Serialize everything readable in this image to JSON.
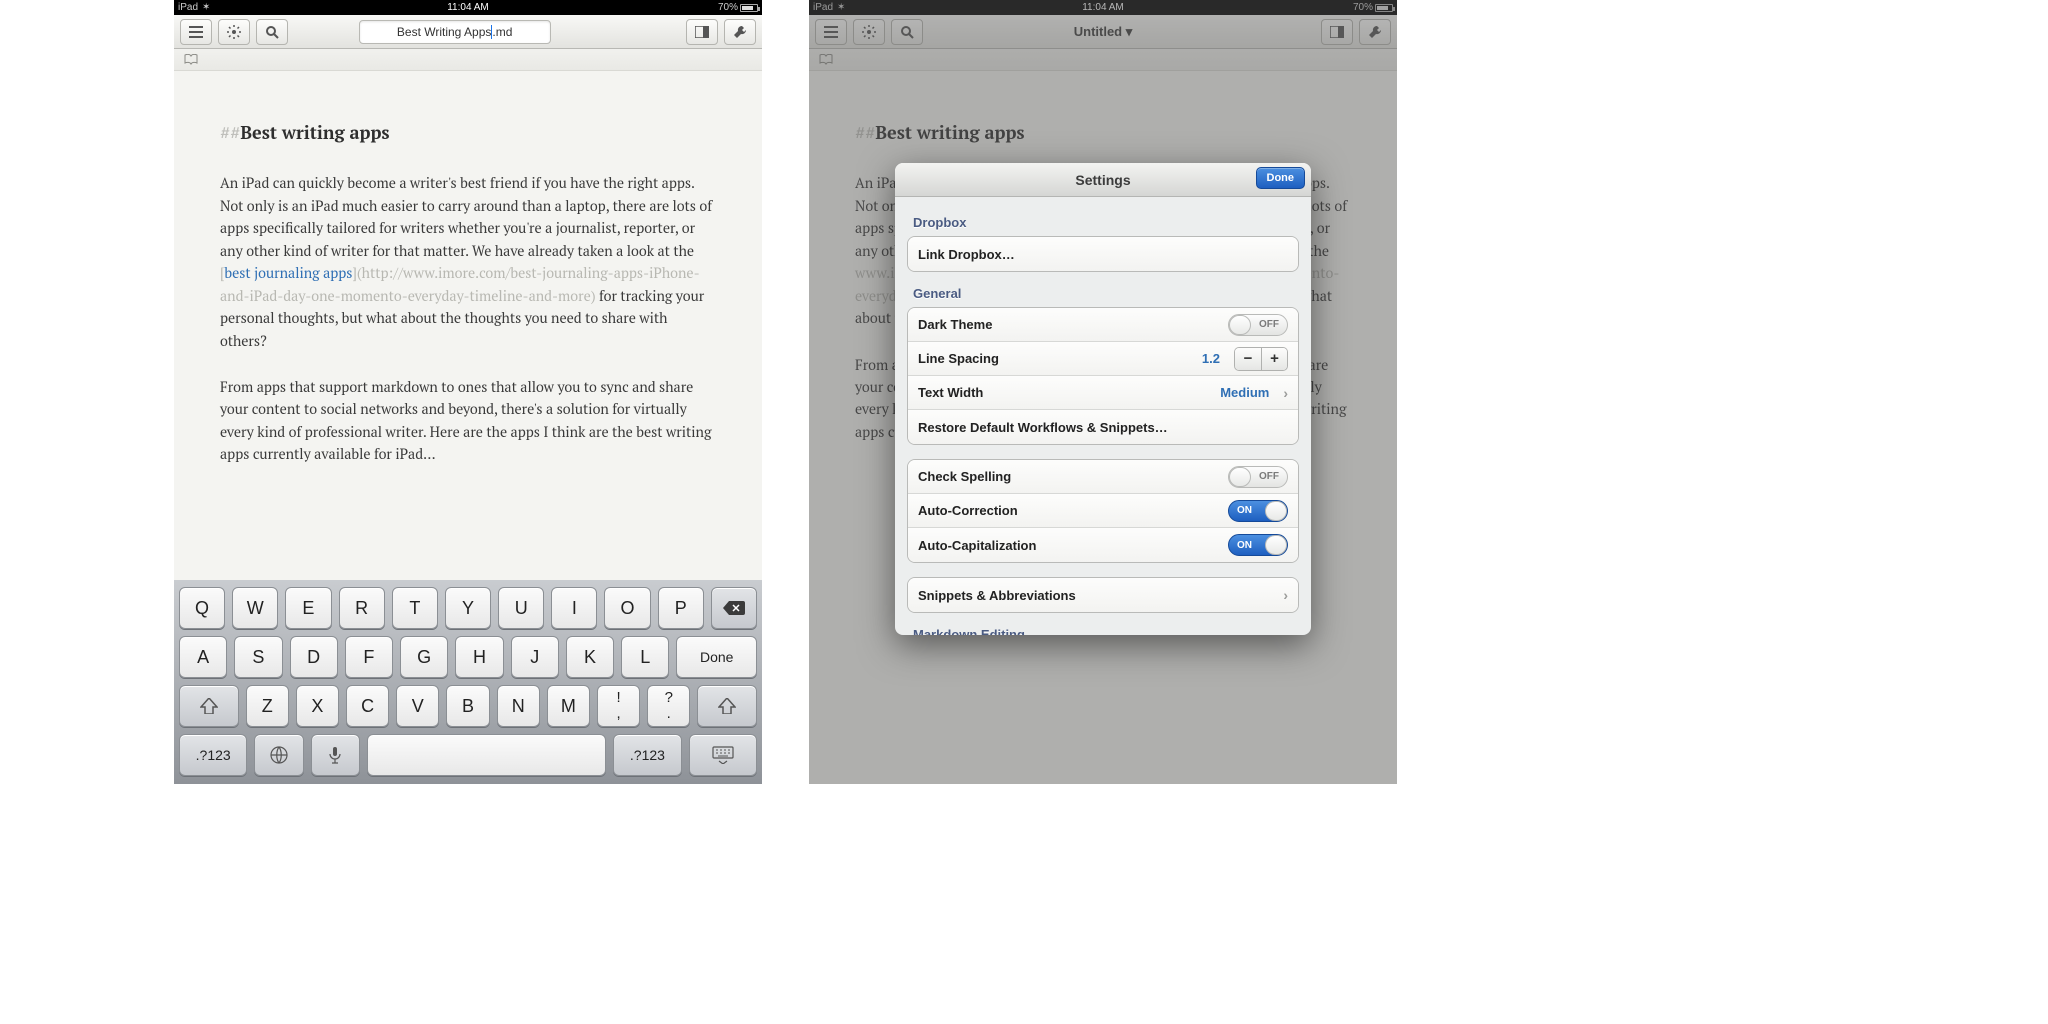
{
  "left": {
    "status": {
      "device": "iPad",
      "time": "11:04 AM",
      "battery": "70%"
    },
    "toolbar": {
      "title_before": "Best Writing Apps",
      "title_after": ".md"
    },
    "editor": {
      "heading_marker": "##",
      "heading": "Best writing apps",
      "p1_a": "An iPad can quickly become a writer's best friend if you have the right apps. Not only is an iPad much easier to  carry around than a laptop, there are lots of apps specifically tailored for writers whether you're a journalist, reporter, or any other kind of writer for that matter. We have already taken a look at the ",
      "link_open": "[",
      "link_text": "best journaling apps",
      "link_close": "]",
      "url": "(http://www.imore.com/best-journaling-apps-iPhone-and-iPad-day-one-momento-everyday-timeline-and-more)",
      "p1_b": " for tracking your personal thoughts, but what about the thoughts you need to share with others?",
      "p2": "From apps that support markdown to ones that allow you to sync and share your content to social networks and beyond, there's a solution for virtually every kind of professional writer. Here are the apps I think are the best writing apps currently available for iPad..."
    },
    "keyboard": {
      "row1": [
        "Q",
        "W",
        "E",
        "R",
        "T",
        "Y",
        "U",
        "I",
        "O",
        "P"
      ],
      "row2": [
        "A",
        "S",
        "D",
        "F",
        "G",
        "H",
        "J",
        "K",
        "L"
      ],
      "done": "Done",
      "row3": [
        "Z",
        "X",
        "C",
        "V",
        "B",
        "N",
        "M"
      ],
      "punct1_top": "!",
      "punct1_bot": ",",
      "punct2_top": "?",
      "punct2_bot": ".",
      "numkey": ".?123"
    }
  },
  "right": {
    "status": {
      "device": "iPad",
      "time": "11:04 AM",
      "battery": "70%"
    },
    "toolbar": {
      "title": "Untitled ▾"
    },
    "editor": {
      "heading_marker": "##",
      "heading": "Best writing apps",
      "p1_a": "An iPad can quickly become a writer's best friend if you have the right apps. Not only is an iPad much easier to  carry around than a laptop, there are lots of apps specifically tailored for writers whether you're a journalist, reporter, or any other kind of writer for that matter. We have already taken a look at the ",
      "url": "www.imore.com/best-journaling-apps-iPhone-and-iPad-day-one-momento-everyday-timeline-and-more)",
      "p1_b": " for tracking your personal thoughts, but what about the thoughts you need to share with others?",
      "p2": "From apps that support markdown to ones that allow you to sync and share your content to social networks and beyond, there's a solution for virtually every kind of professional writer. Here are the apps I think are the best writing apps currently available for iPad..."
    },
    "settings": {
      "title": "Settings",
      "done": "Done",
      "sec_dropbox": "Dropbox",
      "link_dropbox": "Link Dropbox…",
      "sec_general": "General",
      "dark_theme": "Dark Theme",
      "off": "OFF",
      "on": "ON",
      "line_spacing": "Line Spacing",
      "line_spacing_value": "1.2",
      "text_width": "Text Width",
      "text_width_value": "Medium",
      "restore": "Restore Default Workflows & Snippets…",
      "check_spelling": "Check Spelling",
      "auto_correction": "Auto-Correction",
      "auto_cap": "Auto-Capitalization",
      "snippets": "Snippets & Abbreviations",
      "sec_markdown": "Markdown Editing"
    }
  }
}
